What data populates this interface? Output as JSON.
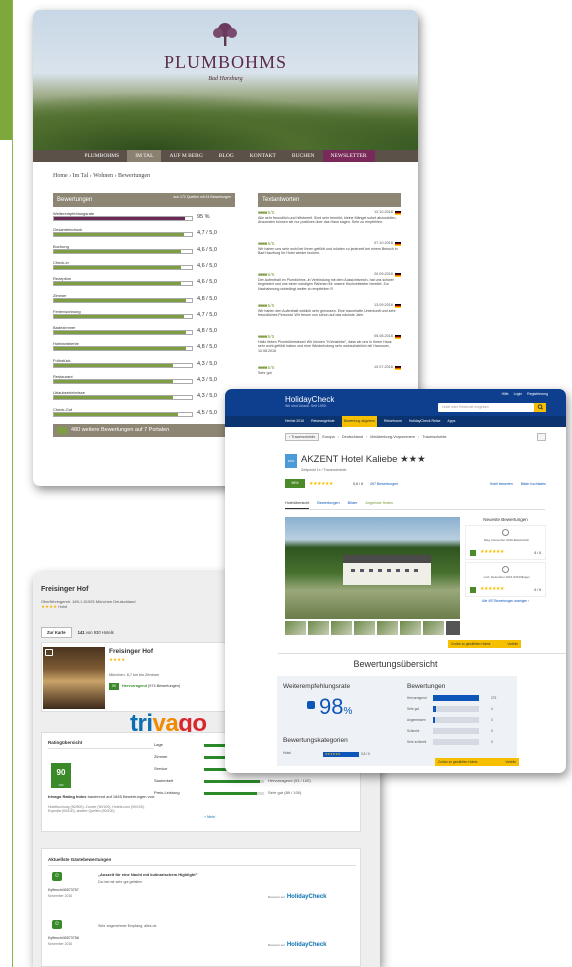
{
  "plumbohms": {
    "brand": "PLUMBOHMS",
    "brand_sub": "Bad Harzburg",
    "nav": [
      "PLUMBOHMS",
      "IM TAL",
      "AUF M BERG",
      "BLOG",
      "KONTAKT",
      "BUCHEN",
      "NEWSLETTER"
    ],
    "nav_active": "IM TAL",
    "breadcrumb": "Home › Im Tal › Wohnen › Bewertungen",
    "ratings_header": "Bewertungen",
    "ratings_header_sub": "aus 172 Quellen mit 44 Bewertungen",
    "ratings": [
      {
        "label": "Weiterempfehlungsrate",
        "value": "95 %",
        "fill": 0.95
      },
      {
        "label": "Gesamteindruck",
        "value": "4,7 / 5,0",
        "fill": 0.94
      },
      {
        "label": "Buchung",
        "value": "4,6 / 5,0",
        "fill": 0.92
      },
      {
        "label": "Check-in",
        "value": "4,6 / 5,0",
        "fill": 0.92
      },
      {
        "label": "Rezeption",
        "value": "4,6 / 5,0",
        "fill": 0.92
      },
      {
        "label": "Zimmer",
        "value": "4,8 / 5,0",
        "fill": 0.96
      },
      {
        "label": "Ferienwohnung",
        "value": "4,7 / 5,0",
        "fill": 0.94
      },
      {
        "label": "Badezimmer",
        "value": "4,8 / 5,0",
        "fill": 0.96
      },
      {
        "label": "Hotelambiente",
        "value": "4,8 / 5,0",
        "fill": 0.96
      },
      {
        "label": "Frühstück",
        "value": "4,3 / 5,0",
        "fill": 0.86
      },
      {
        "label": "Restaurant",
        "value": "4,3 / 5,0",
        "fill": 0.86
      },
      {
        "label": "Urlaubserlebnisse",
        "value": "4,3 / 5,0",
        "fill": 0.86
      },
      {
        "label": "Check-Out",
        "value": "4,5 / 5,0",
        "fill": 0.9
      }
    ],
    "more_reviews": "480 weitere Bewertungen auf 7 Portalen",
    "texts_header": "Textantworten",
    "reviews": [
      {
        "score": "5 / 5",
        "date": "12.10.2016",
        "text": "Alle sehr freundlich und hilfsbereit. Sind sehr bemüht, kleine Mängel sofort abzustellen. Ansonsten können wir nur positives über das Haus sagen. Sehr zu empfehlen."
      },
      {
        "score": "5 / 5",
        "date": "07.10.2016",
        "text": "Wir haben uns sehr wohl bei Ihnen gefühlt und würden zu jederzeit bei einem Besuch in Bad Harzburg Ihr Hotel wieder buchen."
      },
      {
        "score": "5 / 5",
        "date": "20.09.2016",
        "text": "Der Aufenthalt im Plumböhms -in Verbindung mit dem Aussichtsreich- hat uns schwer begeistert und uns einen würdigen Rahmen für unsere Hochzeitsfeier bereitet. Zur Nachahmung unbedingt weiter zu empfehlen !!!"
      },
      {
        "score": "5 / 5",
        "date": "13.09.2016",
        "text": "Wir haben den Aufenthalt wirklich sehr genossen. Eine traumhafte Unterkunft und sehr freundliches Personal. Wir freuen uns schon auf das nächste Jahr."
      },
      {
        "score": "5 / 5",
        "date": "05.08.2016",
        "text": "Hallo lieben Plumböhmsteam! Wir können \"Kühnsliebe\", dass wir uns in Ihrem Haus sehr wohl gefühlt haben und eine Wiederholung sehr wahrscheinlich ist! Hannover, 10.08.2016"
      },
      {
        "score": "5 / 5",
        "date": "10.07.2016",
        "text": "Sehr gut"
      }
    ]
  },
  "holidaycheck": {
    "logo": "HolidayCheck",
    "logo_sub": "Wir sind Urlaub. Seit 1999.",
    "search_placeholder": "Hotel oder Reiseziel eingeben",
    "top_menu": [
      "Hilfe",
      "Login",
      "Registrierung"
    ],
    "nav": [
      "Herbst 2016",
      "Reiseangebote",
      "Bewertung abgeben",
      "Reiseforum",
      "HolidayCheck Reise",
      "Apps"
    ],
    "nav_active": "Bewertung abgeben",
    "back": "‹ Trauerscheide",
    "breadcrumb": [
      "Europa",
      "Deutschland",
      "Mecklenburg-Vorpommern",
      "Trauerscheide"
    ],
    "badge": "2016",
    "hotel_name": "AKZENT Hotel Kaliebe ★★★",
    "location": "Zeitpunkt 1x / Trauerscheide",
    "thumb_pct": "98%",
    "stars": "★★★★★★",
    "rating": "5,6 / 6",
    "count": "497 Bewertungen",
    "actions": [
      "Hotel bewerten",
      "Bilder hochladen"
    ],
    "tabs": [
      "Hotelübersicht",
      "Bewertungen",
      "Bilder",
      "Angebote finden"
    ],
    "newest_title": "Neueste Bewertungen",
    "newest": [
      {
        "name": "Mag. Dezember 2016 Elwicknisch",
        "rating": "6 / 6"
      },
      {
        "name": "Lutz, Dezember 2016 SONNEngel",
        "rating": "6 / 6"
      }
    ],
    "newest_link": "Alle 497 Bewertungen anzeigen ›",
    "cta": "Zurück zu gewählten Hotels",
    "cta_right": "Vorteile",
    "overview_title": "Bewertungsübersicht",
    "rec_label": "Weiterempfehlungsrate",
    "rec_value": "98",
    "rec_unit": "%",
    "cat_label": "Bewertungskategorien",
    "cat_row": "Hotel",
    "cat_value": "5,8 / 6",
    "bw_label": "Bewertungen",
    "bw_rows": [
      {
        "label": "Hervorragend",
        "value": "273",
        "fill": 1.0
      },
      {
        "label": "Sehr gut",
        "value": "4",
        "fill": 0.06
      },
      {
        "label": "Angemessen",
        "value": "3",
        "fill": 0.05
      },
      {
        "label": "Schlecht",
        "value": "0",
        "fill": 0.0
      },
      {
        "label": "Sehr schlecht",
        "value": "0",
        "fill": 0.0
      }
    ],
    "bw_cta": "Zurück zu gewählten Hotels",
    "bw_cta_right": "Vorteile"
  },
  "trivago": {
    "hotel": "Freisinger Hof",
    "address": "Oberföhringerstr. 189-1 81925 München Deutschland",
    "stars": "★★★★",
    "stars_label": "Hotel",
    "tab_map": "Zur Karte",
    "rank": "141",
    "rank_text": "von 930 Hotels",
    "card_name": "Freisinger Hof",
    "card_stars": "★★★★",
    "distance": "München, 8,7 km bis Zentrum",
    "score": "90",
    "score_text": "Hervorragend",
    "score_count": "(974 Bewertungen)",
    "logo": [
      "tri",
      "va",
      "go"
    ],
    "rating_title": "Ratingübersicht",
    "big_score": "90",
    "big_sub": "/100",
    "index_title": "trivago Rating Index",
    "index_text": "basierend auf 1845 Bewertungen von:",
    "sources": "Hotelbuchung (90/500), Zoover (90/100), Hotels.com (90/100), Expedia (90/100), andere Quellen (90/100)",
    "categories": [
      {
        "label": "Lage",
        "value": "",
        "fill": 0.85
      },
      {
        "label": "Zimmer",
        "value": "Hervorragend (93 / 100)",
        "fill": 0.93
      },
      {
        "label": "Service",
        "value": "Hervorragend (93 / 100)",
        "fill": 0.93
      },
      {
        "label": "Sauberkeit",
        "value": "Hervorragend (93 / 100)",
        "fill": 0.93
      },
      {
        "label": "Preis-Leistung",
        "value": "Sehr gut (89 / 100)",
        "fill": 0.89
      }
    ],
    "more": "+ Mehr",
    "guest_title": "Aktuellste Gästebewertungen",
    "guests": [
      {
        "user": "Kyffenchl40573757",
        "date": "November 2016",
        "quote": "„Auszeit für eine Nacht mit kulinarischem Highlight\"",
        "text": "Da hat mir sehr gut gefallen",
        "src_label": "Bewertet auf",
        "src": "HolidayCheck"
      },
      {
        "user": "Kyffenchl40573758",
        "date": "November 2016",
        "quote": "",
        "text": "Sehr angenehmer Empfang, alles ok.",
        "src_label": "Bewertet auf",
        "src": "HolidayCheck"
      }
    ]
  }
}
